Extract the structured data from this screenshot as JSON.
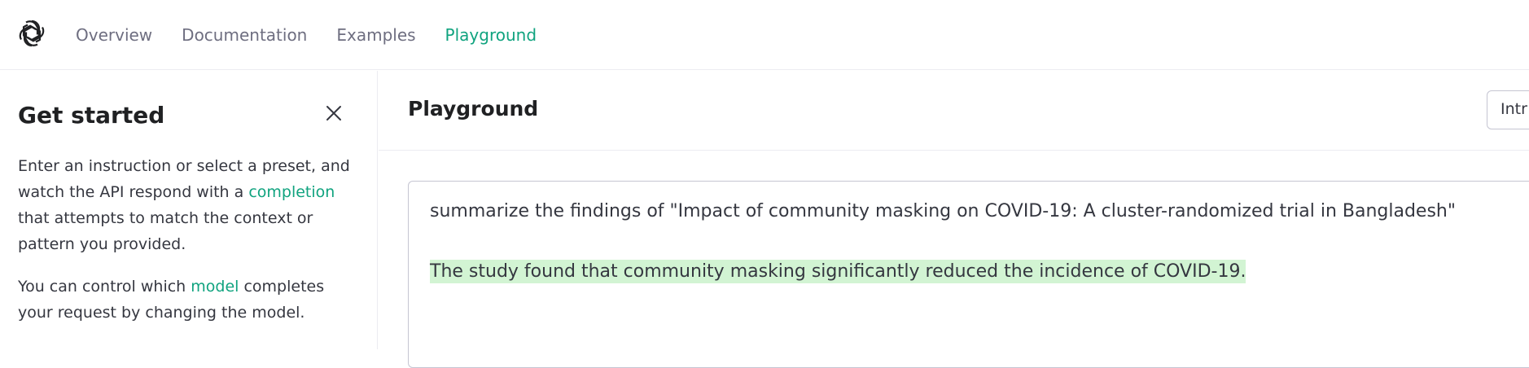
{
  "nav": {
    "logo_icon": "openai-logo-icon",
    "links": [
      "Overview",
      "Documentation",
      "Examples",
      "Playground"
    ],
    "active": "Playground"
  },
  "sidebar": {
    "title": "Get started",
    "close_icon": "close-icon",
    "para1_before": "Enter an instruction or select a preset, and watch the API respond with a ",
    "para1_link": "completion",
    "para1_after": " that attempts to match the context or pattern you provided.",
    "para2_before": "You can control which ",
    "para2_link": "model",
    "para2_after": " completes your request by changing the model."
  },
  "main": {
    "title": "Playground",
    "preset_select_value": "Intr",
    "prompt": "summarize the findings of \"Impact of community masking on COVID-19: A cluster-randomized trial in Bangladesh\"",
    "completion": "The study found that community masking significantly reduced the incidence of COVID-19."
  },
  "colors": {
    "accent": "#10a37f",
    "completion_highlight": "#d2f4d3",
    "border": "#c5c5d2"
  }
}
